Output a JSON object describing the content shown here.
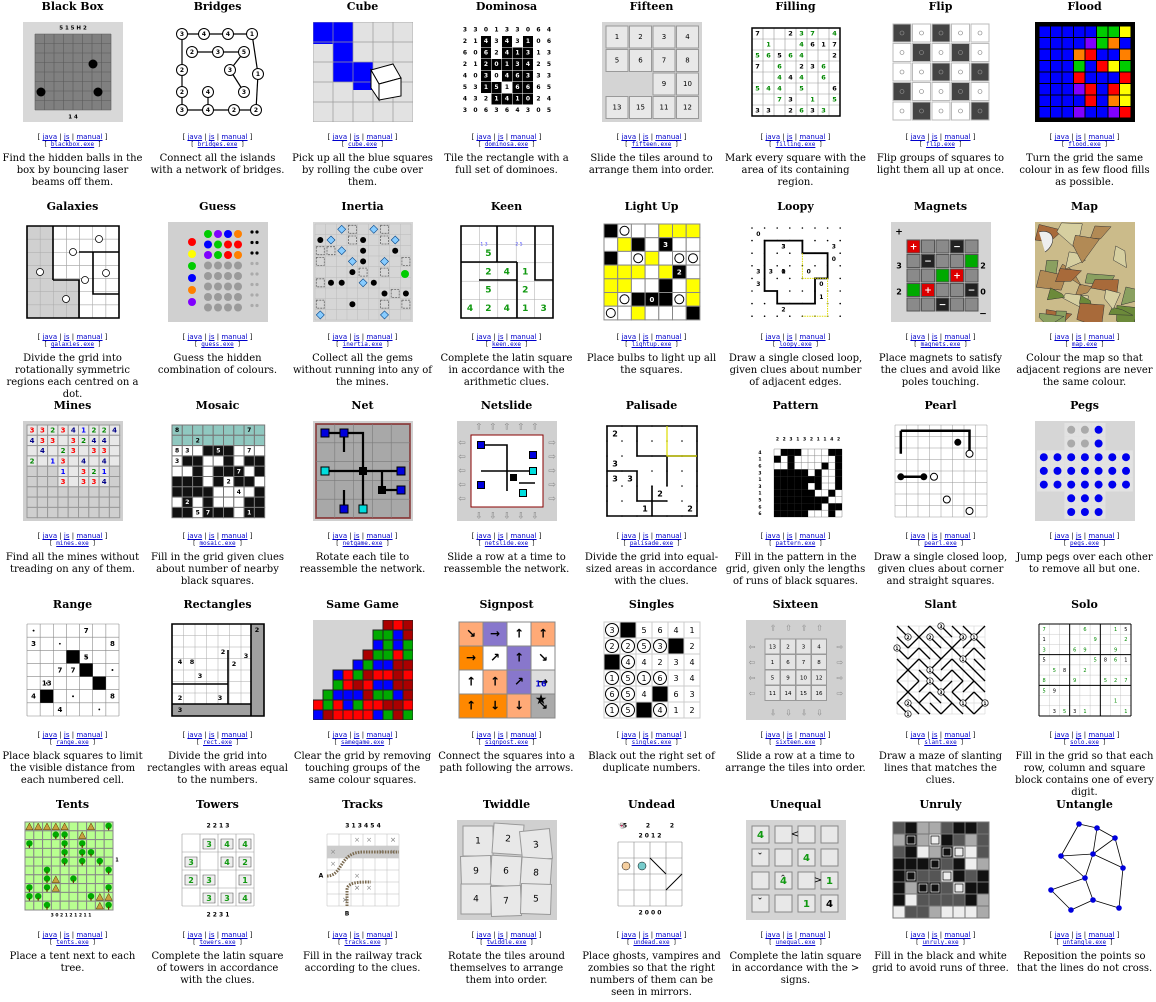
{
  "link_labels": {
    "java": "java",
    "js": "js",
    "manual": "manual"
  },
  "puzzles": [
    {
      "name": "Black Box",
      "exe": "blackbox.exe",
      "desc": "Find the hidden balls in the box by bouncing laser beams off them.",
      "icon": "blackbox"
    },
    {
      "name": "Bridges",
      "exe": "bridges.exe",
      "desc": "Connect all the islands with a network of bridges.",
      "icon": "bridges"
    },
    {
      "name": "Cube",
      "exe": "cube.exe",
      "desc": "Pick up all the blue squares by rolling the cube over them.",
      "icon": "cube"
    },
    {
      "name": "Dominosa",
      "exe": "dominosa.exe",
      "desc": "Tile the rectangle with a full set of dominoes.",
      "icon": "dominosa"
    },
    {
      "name": "Fifteen",
      "exe": "fifteen.exe",
      "desc": "Slide the tiles around to arrange them into order.",
      "icon": "fifteen"
    },
    {
      "name": "Filling",
      "exe": "filling.exe",
      "desc": "Mark every square with the area of its containing region.",
      "icon": "filling"
    },
    {
      "name": "Flip",
      "exe": "flip.exe",
      "desc": "Flip groups of squares to light them all up at once.",
      "icon": "flip"
    },
    {
      "name": "Flood",
      "exe": "flood.exe",
      "desc": "Turn the grid the same colour in as few flood fills as possible.",
      "icon": "flood"
    },
    {
      "name": "Galaxies",
      "exe": "galaxies.exe",
      "desc": "Divide the grid into rotationally symmetric regions each centred on a dot.",
      "icon": "galaxies"
    },
    {
      "name": "Guess",
      "exe": "guess.exe",
      "desc": "Guess the hidden combination of colours.",
      "icon": "guess"
    },
    {
      "name": "Inertia",
      "exe": "inertia.exe",
      "desc": "Collect all the gems without running into any of the mines.",
      "icon": "inertia"
    },
    {
      "name": "Keen",
      "exe": "keen.exe",
      "desc": "Complete the latin square in accordance with the arithmetic clues.",
      "icon": "keen"
    },
    {
      "name": "Light Up",
      "exe": "lightup.exe",
      "desc": "Place bulbs to light up all the squares.",
      "icon": "lightup"
    },
    {
      "name": "Loopy",
      "exe": "loopy.exe",
      "desc": "Draw a single closed loop, given clues about number of adjacent edges.",
      "icon": "loopy"
    },
    {
      "name": "Magnets",
      "exe": "magnets.exe",
      "desc": "Place magnets to satisfy the clues and avoid like poles touching.",
      "icon": "magnets"
    },
    {
      "name": "Map",
      "exe": "map.exe",
      "desc": "Colour the map so that adjacent regions are never the same colour.",
      "icon": "map"
    },
    {
      "name": "Mines",
      "exe": "mines.exe",
      "desc": "Find all the mines without treading on any of them.",
      "icon": "mines"
    },
    {
      "name": "Mosaic",
      "exe": "mosaic.exe",
      "desc": "Fill in the grid given clues about number of nearby black squares.",
      "icon": "mosaic"
    },
    {
      "name": "Net",
      "exe": "netgame.exe",
      "desc": "Rotate each tile to reassemble the network.",
      "icon": "net"
    },
    {
      "name": "Netslide",
      "exe": "netslide.exe",
      "desc": "Slide a row at a time to reassemble the network.",
      "icon": "netslide"
    },
    {
      "name": "Palisade",
      "exe": "palisade.exe",
      "desc": "Divide the grid into equal-sized areas in accordance with the clues.",
      "icon": "palisade"
    },
    {
      "name": "Pattern",
      "exe": "pattern.exe",
      "desc": "Fill in the pattern in the grid, given only the lengths of runs of black squares.",
      "icon": "pattern"
    },
    {
      "name": "Pearl",
      "exe": "pearl.exe",
      "desc": "Draw a single closed loop, given clues about corner and straight squares.",
      "icon": "pearl"
    },
    {
      "name": "Pegs",
      "exe": "pegs.exe",
      "desc": "Jump pegs over each other to remove all but one.",
      "icon": "pegs"
    },
    {
      "name": "Range",
      "exe": "range.exe",
      "desc": "Place black squares to limit the visible distance from each numbered cell.",
      "icon": "range"
    },
    {
      "name": "Rectangles",
      "exe": "rect.exe",
      "desc": "Divide the grid into rectangles with areas equal to the numbers.",
      "icon": "rect"
    },
    {
      "name": "Same Game",
      "exe": "samegame.exe",
      "desc": "Clear the grid by removing touching groups of the same colour squares.",
      "icon": "samegame"
    },
    {
      "name": "Signpost",
      "exe": "signpost.exe",
      "desc": "Connect the squares into a path following the arrows.",
      "icon": "signpost"
    },
    {
      "name": "Singles",
      "exe": "singles.exe",
      "desc": "Black out the right set of duplicate numbers.",
      "icon": "singles"
    },
    {
      "name": "Sixteen",
      "exe": "sixteen.exe",
      "desc": "Slide a row at a time to arrange the tiles into order.",
      "icon": "sixteen"
    },
    {
      "name": "Slant",
      "exe": "slant.exe",
      "desc": "Draw a maze of slanting lines that matches the clues.",
      "icon": "slant"
    },
    {
      "name": "Solo",
      "exe": "solo.exe",
      "desc": "Fill in the grid so that each row, column and square block contains one of every digit.",
      "icon": "solo"
    },
    {
      "name": "Tents",
      "exe": "tents.exe",
      "desc": "Place a tent next to each tree.",
      "icon": "tents"
    },
    {
      "name": "Towers",
      "exe": "towers.exe",
      "desc": "Complete the latin square of towers in accordance with the clues.",
      "icon": "towers"
    },
    {
      "name": "Tracks",
      "exe": "tracks.exe",
      "desc": "Fill in the railway track according to the clues.",
      "icon": "tracks"
    },
    {
      "name": "Twiddle",
      "exe": "twiddle.exe",
      "desc": "Rotate the tiles around themselves to arrange them into order.",
      "icon": "twiddle"
    },
    {
      "name": "Undead",
      "exe": "undead.exe",
      "desc": "Place ghosts, vampires and zombies so that the right numbers of them can be seen in mirrors.",
      "icon": "undead"
    },
    {
      "name": "Unequal",
      "exe": "unequal.exe",
      "desc": "Complete the latin square in accordance with the > signs.",
      "icon": "unequal"
    },
    {
      "name": "Unruly",
      "exe": "unruly.exe",
      "desc": "Fill in the black and white grid to avoid runs of three.",
      "icon": "unruly"
    },
    {
      "name": "Untangle",
      "exe": "untangle.exe",
      "desc": "Reposition the points so that the lines do not cross.",
      "icon": "untangle"
    }
  ],
  "thumb_text": {
    "blackbox": {
      "top": "5 1 5 H 2",
      "left": "2 R H",
      "right": "H 3 3 4",
      "bottom": "1 4"
    },
    "fifteen": [
      "1",
      "2",
      "3",
      "4",
      "5",
      "6",
      "7",
      "8",
      "9",
      "10",
      "13",
      "15",
      "11",
      "12"
    ],
    "sixteen": [
      "13",
      "2",
      "3",
      "4",
      "1",
      "6",
      "7",
      "8",
      "5",
      "9",
      "10",
      "12",
      "11",
      "14",
      "15",
      "16"
    ],
    "twiddle": [
      "1",
      "2",
      "3",
      "9",
      "6",
      "8",
      "4",
      "7",
      "5"
    ],
    "towers_top": "2 2 1 3",
    "towers_bottom": "2 2 3 1",
    "tracks_top": "3 1 3 4 5 4",
    "tracks_labels": [
      "A",
      "B"
    ],
    "undead_counts": [
      "5",
      "2",
      "2"
    ],
    "undead_top": "2 0 1 2",
    "undead_bottom": "2 0 0 0",
    "unequal": [
      "4",
      "4",
      "4",
      "1",
      "1",
      "4"
    ],
    "keen_nums": [
      "2",
      "4",
      "1",
      "5",
      "2",
      "4",
      "2",
      "4",
      "1",
      "3",
      "5"
    ],
    "singles": [
      "3",
      "1",
      "5",
      "6",
      "4",
      "1",
      "2",
      "2",
      "5",
      "3",
      "5",
      "2",
      "1",
      "4",
      "4",
      "2",
      "3",
      "4",
      "1",
      "5",
      "1",
      "6",
      "3",
      "4",
      "6",
      "5",
      "4",
      "1",
      "6"
    ]
  }
}
